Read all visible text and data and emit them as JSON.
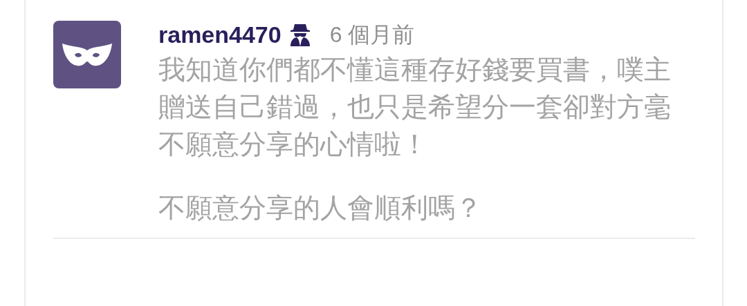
{
  "comment": {
    "username": "ramen4470",
    "anonymous": true,
    "time": "6 個月前",
    "paragraphs": [
      "我知道你們都不懂這種存好錢要買書，噗主贈送自己錯過，也只是希望分一套卻對方毫不願意分享的心情啦！",
      "不願意分享的人會順利嗎？"
    ]
  }
}
